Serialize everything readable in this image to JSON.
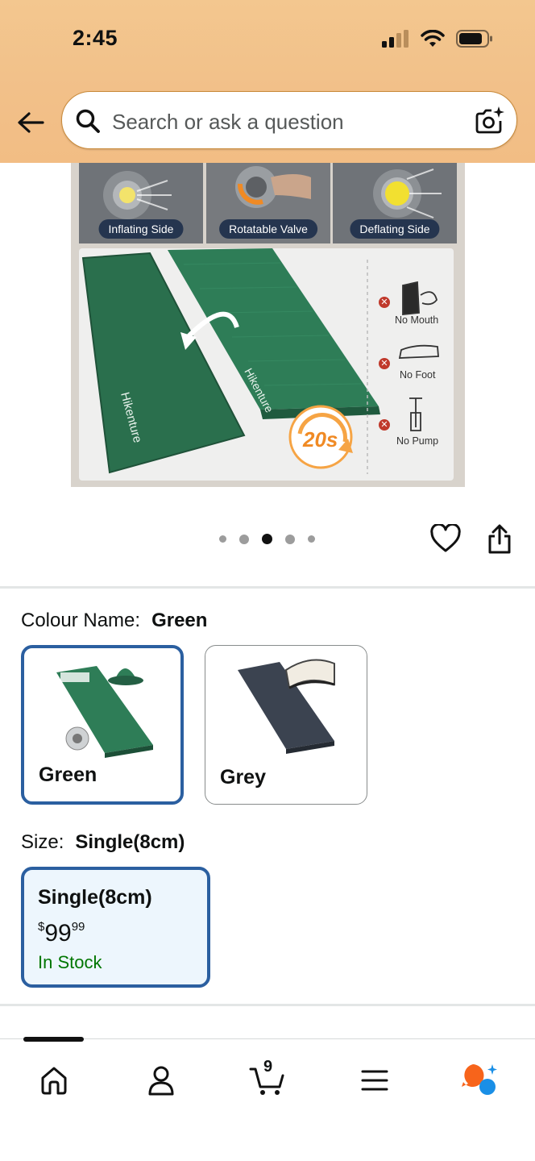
{
  "status_bar": {
    "time": "2:45"
  },
  "search": {
    "placeholder": "Search or ask a question"
  },
  "product_image": {
    "tiles": [
      {
        "label": "Inflating Side"
      },
      {
        "label": "Rotatable Valve"
      },
      {
        "label": "Deflating Side"
      }
    ],
    "features": [
      "No Mouth",
      "No Foot",
      "No Pump"
    ],
    "brand": "Hikenture",
    "badge": "20s"
  },
  "carousel": {
    "count": 5,
    "active_index": 2
  },
  "colour": {
    "label": "Colour Name:",
    "selected": "Green",
    "options": [
      {
        "name": "Green",
        "selected": true
      },
      {
        "name": "Grey",
        "selected": false
      }
    ]
  },
  "size": {
    "label": "Size:",
    "selected": "Single(8cm)",
    "option": {
      "name": "Single(8cm)",
      "currency": "$",
      "whole": "99",
      "fraction": "99",
      "availability": "In Stock"
    }
  },
  "bottom_nav": {
    "items": [
      "home-icon",
      "account-icon",
      "cart-icon",
      "menu-icon",
      "rufus-icon"
    ],
    "cart_count": "9"
  },
  "colors": {
    "accent_blue": "#2b5fa0",
    "stock_green": "#007600",
    "header_orange": "#f2c089",
    "mat_green": "#2e7d57"
  }
}
